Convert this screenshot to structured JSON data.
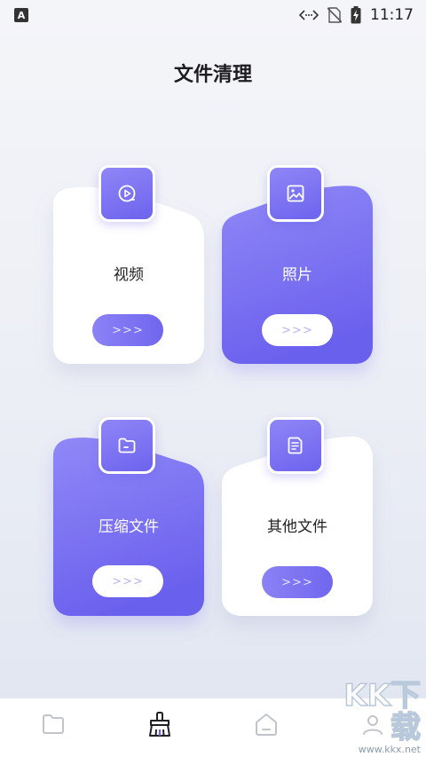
{
  "status_bar": {
    "app_badge": "A",
    "time": "11:17",
    "icons": [
      "code-sync-icon",
      "no-sim-icon",
      "battery-charging-icon"
    ]
  },
  "page": {
    "title": "文件清理"
  },
  "cards": [
    {
      "label": "视频",
      "button_text": ">>>",
      "icon": "video-play-icon",
      "style": "white"
    },
    {
      "label": "照片",
      "button_text": ">>>",
      "icon": "image-icon",
      "style": "purple"
    },
    {
      "label": "压缩文件",
      "button_text": ">>>",
      "icon": "folder-icon",
      "style": "purple"
    },
    {
      "label": "其他文件",
      "button_text": ">>>",
      "icon": "document-icon",
      "style": "white"
    }
  ],
  "bottom_nav": {
    "items": [
      {
        "icon": "folder-icon",
        "selected": false
      },
      {
        "icon": "broom-clean-icon",
        "selected": true
      },
      {
        "icon": "home-icon",
        "selected": false
      },
      {
        "icon": "profile-icon",
        "selected": false
      }
    ]
  },
  "watermark": {
    "logo_text": "KK下载",
    "url": "www.kkx.net"
  },
  "colors": {
    "accent": "#7066ef",
    "accent_light": "#8f86f7",
    "card_white": "#ffffff",
    "text": "#222222"
  }
}
